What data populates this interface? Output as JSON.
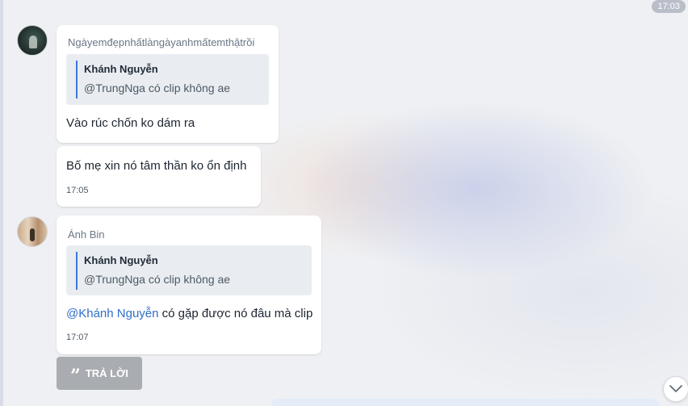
{
  "header": {
    "time_pill": "17:03"
  },
  "messages": [
    {
      "sender": "Ngàyemđẹpnhấtlàngàyanhmấtemthậtrồi",
      "quote": {
        "name": "Khánh Nguyễn",
        "text": "@TrungNga có clip không ae"
      },
      "text": "Vào rúc chốn ko dám ra"
    },
    {
      "text": "Bố mẹ xin nó tâm thần ko ổn định",
      "time": "17:05"
    },
    {
      "sender": "Ánh Bin",
      "quote": {
        "name": "Khánh Nguyễn",
        "text": "@TrungNga có clip không ae"
      },
      "mention": "@Khánh Nguyễn",
      "text": " có gặp được nó đâu mà clip",
      "time": "17:07"
    }
  ],
  "reply_button": {
    "icon": "quote-icon",
    "label": "TRẢ LỜI"
  },
  "scroll_button": {
    "icon": "chevron-down-icon"
  },
  "colors": {
    "mention": "#2f6fc8",
    "quote_bar": "#3c78d8",
    "reply_button_bg": "#a9acb0"
  }
}
